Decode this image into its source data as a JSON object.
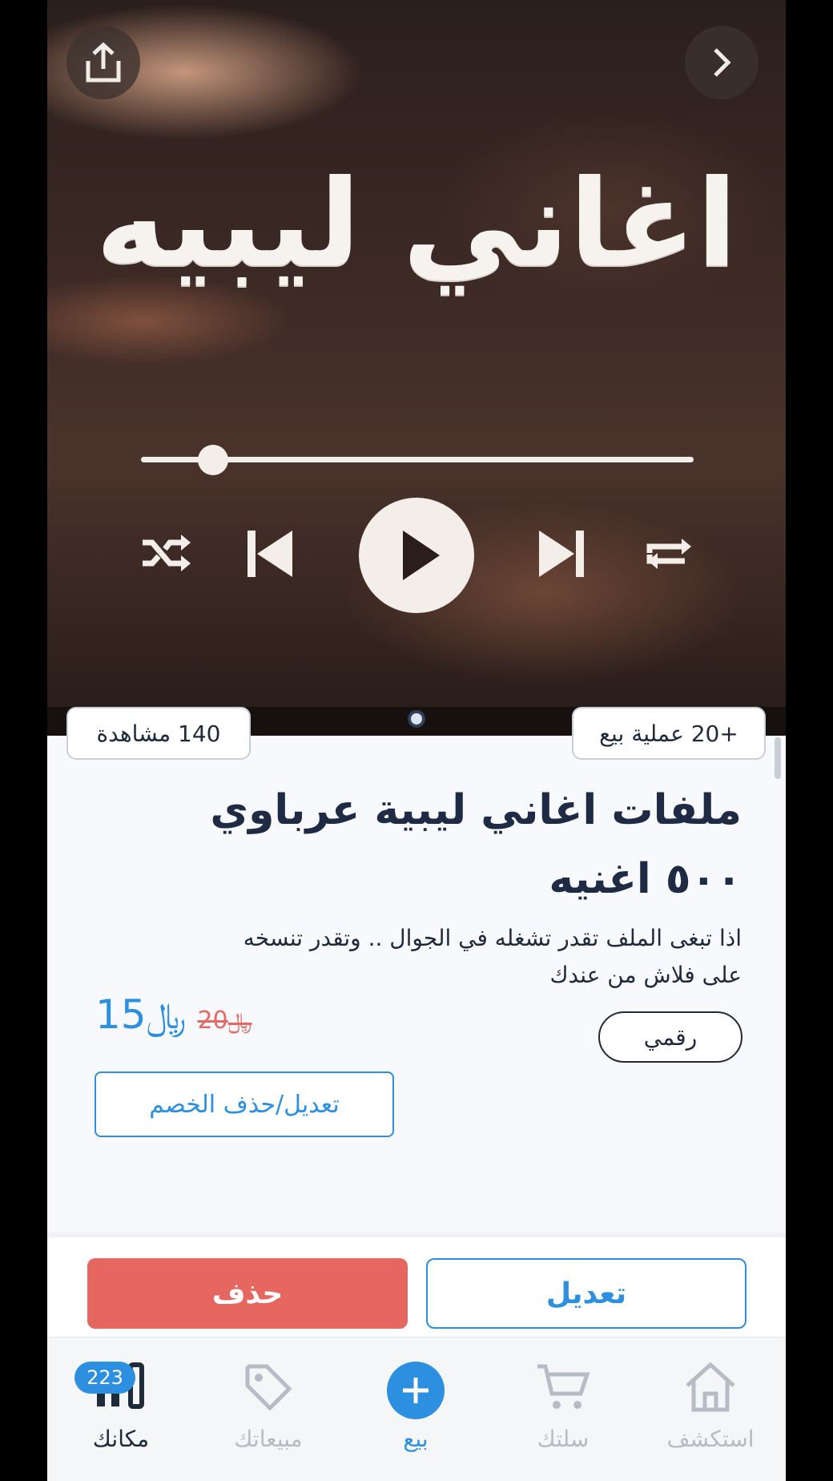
{
  "hero": {
    "image_title": "اغاني ليبيه",
    "progress": 0.13
  },
  "stats": {
    "sales": "+20 عملية بيع",
    "views": "140 مشاهدة"
  },
  "product": {
    "title": "ملفات اغاني ليبية عرباوي ٥٠٠ اغنيه",
    "description": "اذا تبغى الملف تقدر تشغله في الجوال .. وتقدر تنسخه على فلاش من عندك",
    "price_new": "15",
    "price_old": "20",
    "currency_symbol": "﷼",
    "type": "رقمي",
    "discount_button": "تعديل/حذف الخصم"
  },
  "actions": {
    "edit": "تعديل",
    "delete": "حذف"
  },
  "tabbar": {
    "explore": "استكشف",
    "cart": "سلتك",
    "sell": "بيع",
    "sales": "مبيعاتك",
    "shop": "مكانك",
    "shop_badge": "223"
  },
  "colors": {
    "accent": "#2d8fe0",
    "danger": "#e66660",
    "text": "#1f2a3a"
  }
}
